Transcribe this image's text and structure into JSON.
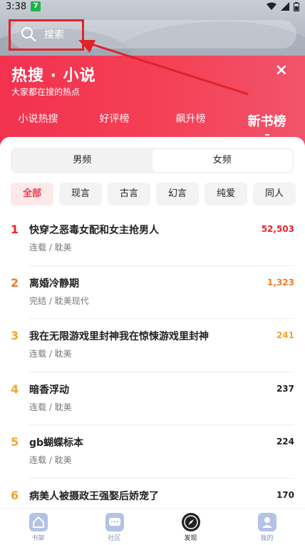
{
  "status_bar": {
    "time": "3:38",
    "app_badge": "7"
  },
  "search": {
    "label": "搜索"
  },
  "banner": {
    "title": "热搜 · 小说",
    "subtitle": "大家都在搜的热点",
    "close_icon": "×"
  },
  "tabs": [
    {
      "label": "小说热搜"
    },
    {
      "label": "好评榜"
    },
    {
      "label": "飙升榜"
    },
    {
      "label": "新书榜",
      "active": true
    }
  ],
  "gender": {
    "options": [
      "男频",
      "女频"
    ],
    "selected": "女频"
  },
  "chips": [
    "全部",
    "现言",
    "古言",
    "幻言",
    "纯爱",
    "同人"
  ],
  "rankings": [
    {
      "rank": "1",
      "title": "快穿之恶毒女配和女主抢男人",
      "meta": "连载 / 耽美",
      "score": "52,503",
      "color": "#e8252b"
    },
    {
      "rank": "2",
      "title": "离婚冷静期",
      "meta": "完结 / 耽美现代",
      "score": "1,323",
      "color": "#ef7a26"
    },
    {
      "rank": "3",
      "title": "我在无限游戏里封神我在惊悚游戏里封神",
      "meta": "连载 / 耽美",
      "score": "241",
      "color": "#f0a62c"
    },
    {
      "rank": "4",
      "title": "暗香浮动",
      "meta": "连载 / 耽美",
      "score": "237",
      "color": "#f0a62c"
    },
    {
      "rank": "5",
      "title": "gb蝴蝶标本",
      "meta": "连载 / 耽美",
      "score": "224",
      "color": "#f0a62c"
    },
    {
      "rank": "6",
      "title": "病美人被摄政王强娶后娇宠了",
      "meta": "",
      "score": "170",
      "color": "#f0a62c"
    }
  ],
  "bottom_nav": [
    {
      "label": "书架",
      "icon": "bookshelf-icon"
    },
    {
      "label": "社区",
      "icon": "community-icon"
    },
    {
      "label": "发现",
      "icon": "discover-icon",
      "active": true
    },
    {
      "label": "我的",
      "icon": "profile-icon"
    }
  ],
  "colors": {
    "accent": "#f43f55",
    "rank_top": "#e8252b"
  }
}
